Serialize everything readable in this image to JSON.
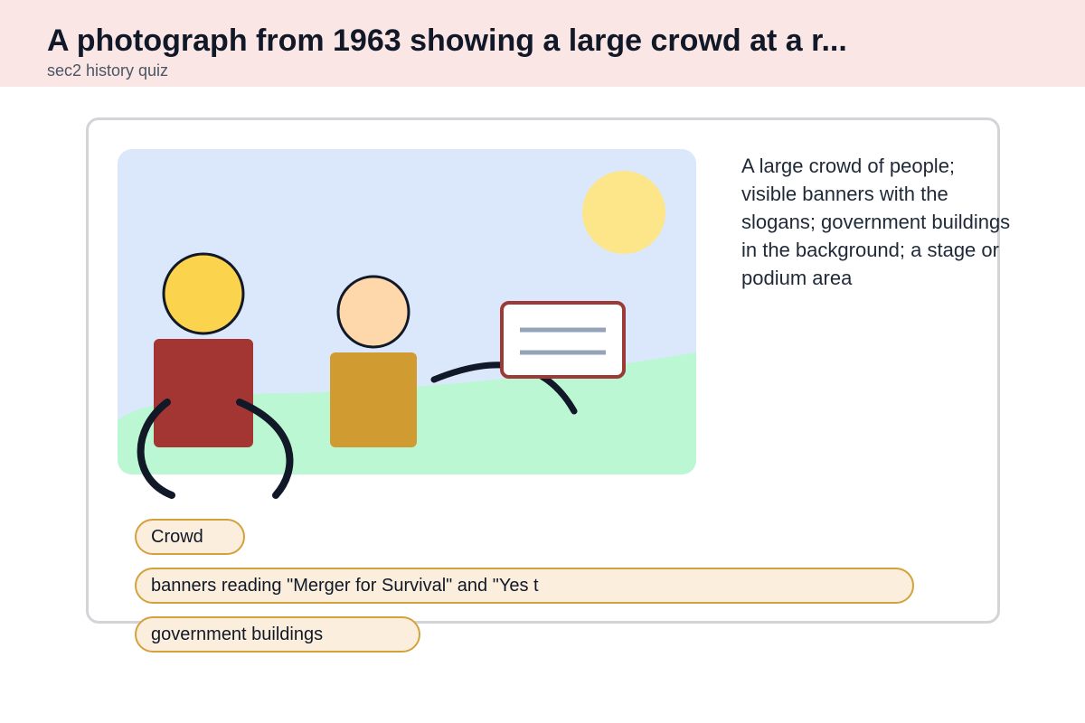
{
  "header": {
    "title": "A photograph from 1963 showing a large crowd at a r...",
    "subtitle": "sec2 history quiz"
  },
  "description": "A large crowd of people; visible banners with the slogans; government buildings in the background; a stage or podium area",
  "tags": [
    "Crowd",
    "banners reading \"Merger for Survival\" and \"Yes t",
    "government buildings"
  ],
  "colors": {
    "sky": "#dbe8fc",
    "grass": "#bbf7d3",
    "sun": "#fde68a",
    "person1_head": "#fcd34d",
    "person1_body": "#a33532",
    "person2_head": "#fed7aa",
    "person2_body": "#d09b30",
    "sign_border": "#9b3a37",
    "tag_border": "#d4a23c",
    "tag_fill": "#fbeedc"
  }
}
